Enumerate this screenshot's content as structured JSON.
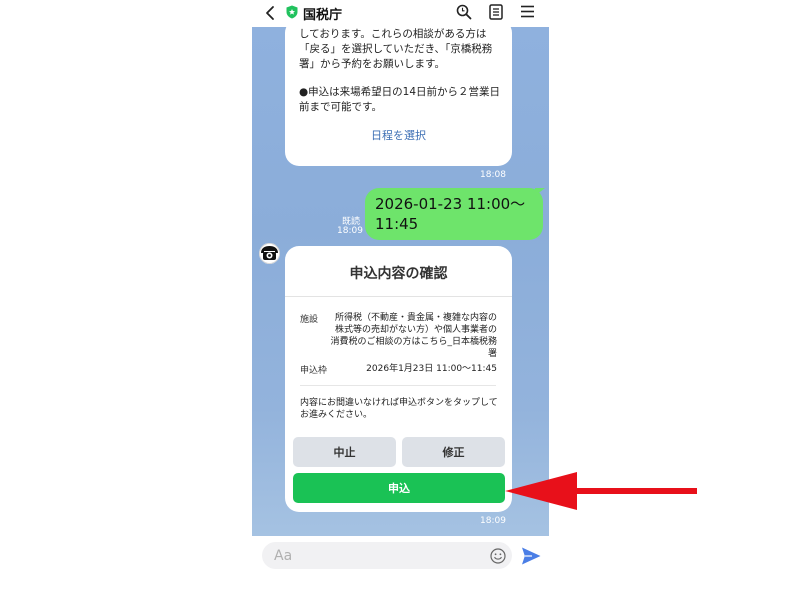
{
  "header": {
    "title": "国税庁",
    "badge_color": "#21c25e"
  },
  "chat": {
    "top_card": {
      "paragraph1": "しております。これらの相談がある方は「戻る」を選択していただき、「京橋税務署」から予約をお願いします。",
      "paragraph2": "●申込は来場希望日の14日前から２営業日前まで可能です。",
      "action_label": "日程を選択",
      "time": "18:08"
    },
    "outgoing": {
      "text": "2026-01-23 11:00～11:45",
      "read_label": "既読",
      "time": "18:09"
    },
    "confirm_card": {
      "title": "申込内容の確認",
      "facility_label": "施設",
      "facility_value": "所得税（不動産・貴金属・複雑な内容の株式等の売却がない方）や個人事業者の消費税のご相談の方はこちら_日本橋税務署",
      "slot_label": "申込枠",
      "slot_value": "2026年1月23日 11:00～11:45",
      "notice": "内容にお間違いなければ申込ボタンをタップしてお進みください。",
      "cancel_label": "中止",
      "edit_label": "修正",
      "apply_label": "申込",
      "time": "18:09"
    }
  },
  "input": {
    "placeholder": "Aa"
  },
  "colors": {
    "apply_button": "#1ac255",
    "outgoing_bubble": "#6ee46b",
    "annotation_arrow": "#e8101a"
  }
}
